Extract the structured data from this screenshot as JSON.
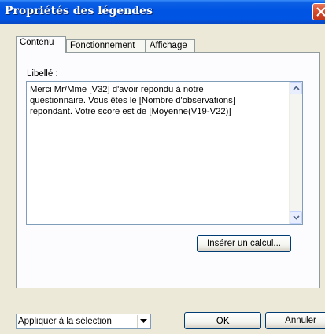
{
  "window": {
    "title": "Propriétés des légendes"
  },
  "tabs": [
    {
      "label": "Contenu",
      "active": true
    },
    {
      "label": "Fonctionnement",
      "active": false
    },
    {
      "label": "Affichage",
      "active": false
    }
  ],
  "content": {
    "label": "Libellé :",
    "text": "Merci Mr/Mme [V32] d'avoir répondu à notre\nquestionnaire. Vous êtes le [Nombre d'observations]\nrépondant. Votre score est de [Moyenne(V19-V22)]",
    "insert_button": "Insérer un calcul..."
  },
  "footer": {
    "apply_select": {
      "value": "Appliquer à la sélection"
    },
    "ok_label": "OK",
    "cancel_label": "Annuler"
  },
  "colors": {
    "titlebar": "#0054E3",
    "dialog_bg": "#ECE9D8",
    "close_button": "#D54A2A"
  },
  "icons": {
    "close": "close-icon",
    "scroll_up": "chevron-up-icon",
    "scroll_down": "chevron-down-icon",
    "select_arrow": "dropdown-arrow-icon"
  }
}
